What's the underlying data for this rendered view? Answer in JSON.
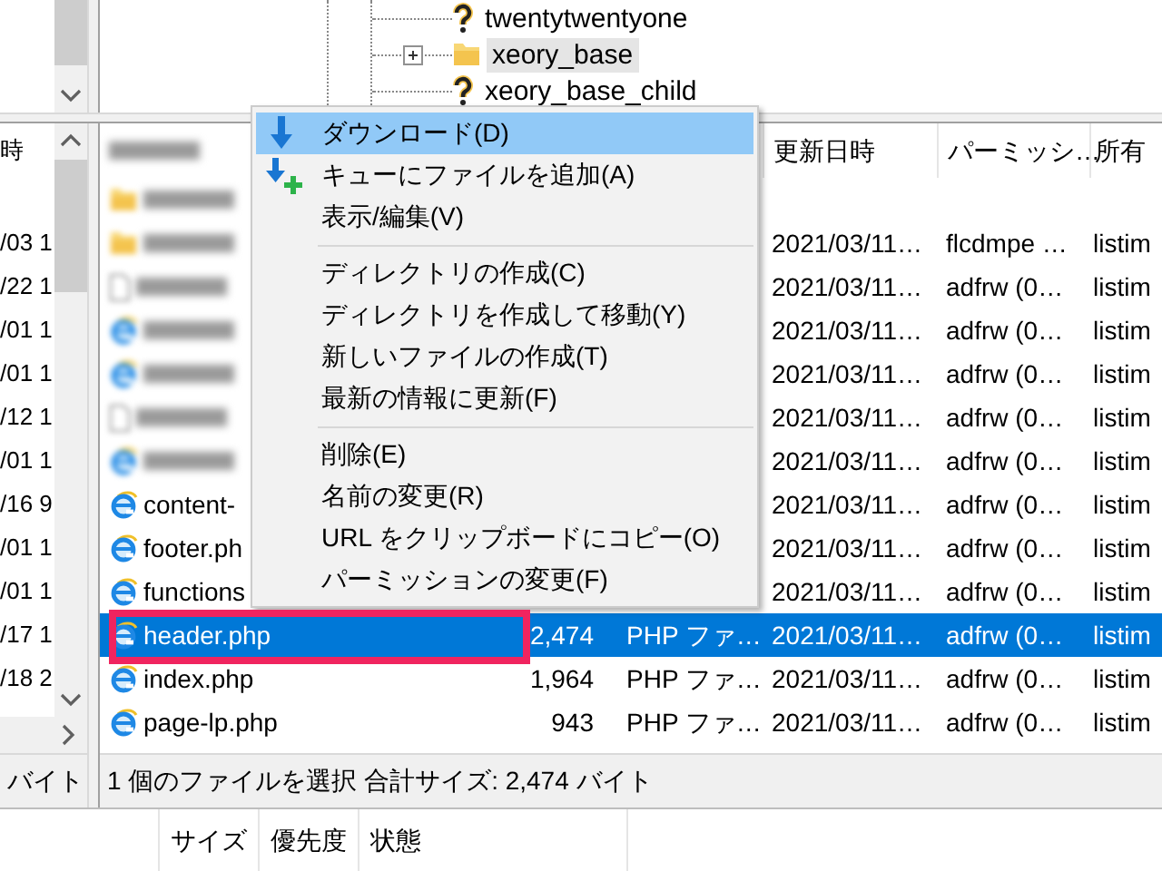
{
  "remote_tree": {
    "items": [
      {
        "name": "twentytwentyone",
        "kind": "unknown",
        "expandable": false,
        "selected": false
      },
      {
        "name": "xeory_base",
        "kind": "folder",
        "expandable": true,
        "selected": true
      },
      {
        "name": "xeory_base_child",
        "kind": "unknown",
        "expandable": false,
        "selected": false
      }
    ]
  },
  "local_list": {
    "column_1": "時",
    "rows": [
      "/03 1",
      "/22 1",
      "/01 1",
      "/01 1",
      "/12 1",
      "/01 1",
      "/16 9",
      "/01 1",
      "/01 1",
      "/17 1",
      "/18 2"
    ],
    "status": "バイト"
  },
  "remote_list": {
    "columns": [
      "更新日時",
      "パーミッシ…",
      "所有"
    ],
    "rows": [
      {
        "kind": "folder",
        "blurred": true,
        "selected": false,
        "highlighted": false
      },
      {
        "kind": "folder",
        "blurred": true,
        "modified": "2021/03/11…",
        "permissions": "flcdmpe …",
        "owner": "listim",
        "selected": false,
        "highlighted": false
      },
      {
        "kind": "file",
        "blurred": true,
        "modified": "2021/03/11…",
        "permissions": "adfrw (0…",
        "owner": "listim",
        "selected": false,
        "highlighted": false
      },
      {
        "kind": "php",
        "blurred": true,
        "modified": "2021/03/11…",
        "permissions": "adfrw (0…",
        "owner": "listim",
        "selected": false,
        "highlighted": false
      },
      {
        "kind": "php",
        "blurred": true,
        "modified": "2021/03/11…",
        "permissions": "adfrw (0…",
        "owner": "listim",
        "selected": false,
        "highlighted": false
      },
      {
        "kind": "file",
        "blurred": true,
        "modified": "2021/03/11…",
        "permissions": "adfrw (0…",
        "owner": "listim",
        "selected": false,
        "highlighted": false
      },
      {
        "kind": "php",
        "blurred": true,
        "modified": "2021/03/11…",
        "permissions": "adfrw (0…",
        "owner": "listim",
        "selected": false,
        "highlighted": false
      },
      {
        "kind": "php",
        "blurred": false,
        "name": "content-",
        "modified": "2021/03/11…",
        "permissions": "adfrw (0…",
        "owner": "listim",
        "selected": false,
        "highlighted": false
      },
      {
        "kind": "php",
        "blurred": false,
        "name": "footer.ph",
        "modified": "2021/03/11…",
        "permissions": "adfrw (0…",
        "owner": "listim",
        "selected": false,
        "highlighted": false
      },
      {
        "kind": "php",
        "blurred": false,
        "name": "functions",
        "modified": "2021/03/11…",
        "permissions": "adfrw (0…",
        "owner": "listim",
        "selected": false,
        "highlighted": false
      },
      {
        "kind": "php",
        "blurred": false,
        "name": "header.php",
        "size": "2,474",
        "type": "PHP ファ…",
        "modified": "2021/03/11…",
        "permissions": "adfrw (0…",
        "owner": "listim",
        "selected": true,
        "highlighted": true
      },
      {
        "kind": "php",
        "blurred": false,
        "name": "index.php",
        "size": "1,964",
        "type": "PHP ファ…",
        "modified": "2021/03/11…",
        "permissions": "adfrw (0…",
        "owner": "listim",
        "selected": false,
        "highlighted": false
      },
      {
        "kind": "php",
        "blurred": false,
        "name": "page-lp.php",
        "size": "943",
        "type": "PHP ファ…",
        "modified": "2021/03/11…",
        "permissions": "adfrw (0…",
        "owner": "listim",
        "selected": false,
        "highlighted": false
      }
    ],
    "status": "1 個のファイルを選択 合計サイズ: 2,474 バイト"
  },
  "context_menu": {
    "items": [
      {
        "kind": "download",
        "label": "ダウンロード(D)",
        "selected": true
      },
      {
        "kind": "enqueue",
        "label": "キューにファイルを追加(A)",
        "selected": false
      },
      {
        "kind": "plain",
        "label": "表示/編集(V)",
        "selected": false
      },
      {
        "kind": "separator"
      },
      {
        "kind": "plain",
        "label": "ディレクトリの作成(C)",
        "selected": false
      },
      {
        "kind": "plain",
        "label": "ディレクトリを作成して移動(Y)",
        "selected": false
      },
      {
        "kind": "plain",
        "label": "新しいファイルの作成(T)",
        "selected": false
      },
      {
        "kind": "plain",
        "label": "最新の情報に更新(F)",
        "selected": false
      },
      {
        "kind": "separator"
      },
      {
        "kind": "plain",
        "label": "削除(E)",
        "selected": false
      },
      {
        "kind": "plain",
        "label": "名前の変更(R)",
        "selected": false
      },
      {
        "kind": "plain",
        "label": "URL をクリップボードにコピー(O)",
        "selected": false
      },
      {
        "kind": "plain",
        "label": "パーミッションの変更(F)",
        "selected": false
      }
    ]
  },
  "queue": {
    "columns": [
      "サイズ",
      "優先度",
      "状態"
    ]
  }
}
